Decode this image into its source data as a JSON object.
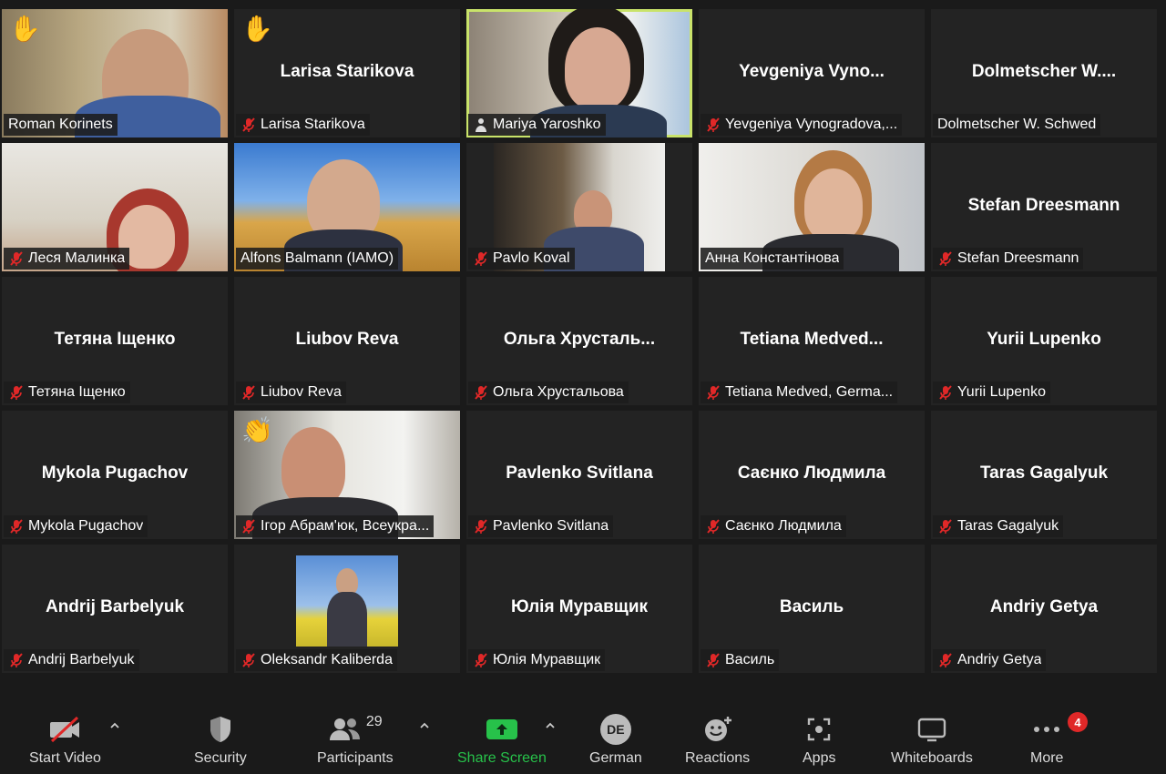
{
  "tiles": [
    {
      "display": "Roman Korinets",
      "label": "Roman Korinets",
      "mic": "none",
      "emoji": "✋"
    },
    {
      "display": "Larisa Starikova",
      "label": "Larisa Starikova",
      "mic": "muted",
      "emoji": "✋"
    },
    {
      "display": "Mariya Yaroshko",
      "label": "Mariya Yaroshko",
      "mic": "interpreter"
    },
    {
      "display": "Yevgeniya  Vyno...",
      "label": "Yevgeniya Vynogradova,...",
      "mic": "muted"
    },
    {
      "display": "Dolmetscher  W....",
      "label": "Dolmetscher W. Schwed",
      "mic": "none"
    },
    {
      "display": "Леся Малинка",
      "label": "Леся Малинка",
      "mic": "muted"
    },
    {
      "display": "Alfons Balmann (IAMO)",
      "label": "Alfons Balmann (IAMO)",
      "mic": "none"
    },
    {
      "display": "Pavlo Koval",
      "label": "Pavlo Koval",
      "mic": "muted"
    },
    {
      "display": "Анна Константінова",
      "label": "Анна Константінова",
      "mic": "none"
    },
    {
      "display": "Stefan Dreesmann",
      "label": "Stefan Dreesmann",
      "mic": "muted"
    },
    {
      "display": "Тетяна Іщенко",
      "label": "Тетяна Іщенко",
      "mic": "muted"
    },
    {
      "display": "Liubov Reva",
      "label": "Liubov Reva",
      "mic": "muted"
    },
    {
      "display": "Ольга  Хрусталь...",
      "label": "Ольга Хрустальова",
      "mic": "muted"
    },
    {
      "display": "Tetiana  Medved...",
      "label": "Tetiana Medved, Germa...",
      "mic": "muted"
    },
    {
      "display": "Yurii Lupenko",
      "label": "Yurii Lupenko",
      "mic": "muted"
    },
    {
      "display": "Mykola Pugachov",
      "label": "Mykola Pugachov",
      "mic": "muted"
    },
    {
      "display": "Ігор Абрам'юк, Всеукра...",
      "label": "Ігор Абрам'юк, Всеукра...",
      "mic": "muted",
      "emoji": "👏"
    },
    {
      "display": "Pavlenko Svitlana",
      "label": "Pavlenko Svitlana",
      "mic": "muted"
    },
    {
      "display": "Саєнко Людмила",
      "label": "Саєнко Людмила",
      "mic": "muted"
    },
    {
      "display": "Taras Gagalyuk",
      "label": "Taras Gagalyuk",
      "mic": "muted"
    },
    {
      "display": "Andrij Barbelyuk",
      "label": "Andrij Barbelyuk",
      "mic": "muted"
    },
    {
      "display": "Oleksandr Kaliberda",
      "label": "Oleksandr Kaliberda",
      "mic": "muted"
    },
    {
      "display": "Юлія Муравщик",
      "label": "Юлія Муравщик",
      "mic": "muted"
    },
    {
      "display": "Василь",
      "label": "Василь",
      "mic": "muted"
    },
    {
      "display": "Andriy Getya",
      "label": "Andriy Getya",
      "mic": "muted"
    }
  ],
  "toolbar": {
    "start_video": "Start Video",
    "security": "Security",
    "participants": "Participants",
    "participants_count": "29",
    "share_screen": "Share Screen",
    "language": "German",
    "language_avatar": "DE",
    "reactions": "Reactions",
    "apps": "Apps",
    "whiteboards": "Whiteboards",
    "more": "More",
    "more_badge": "4"
  },
  "colors": {
    "active_speaker": "#c9e36a",
    "share_green": "#27c24a",
    "muted_red": "#e02828"
  }
}
